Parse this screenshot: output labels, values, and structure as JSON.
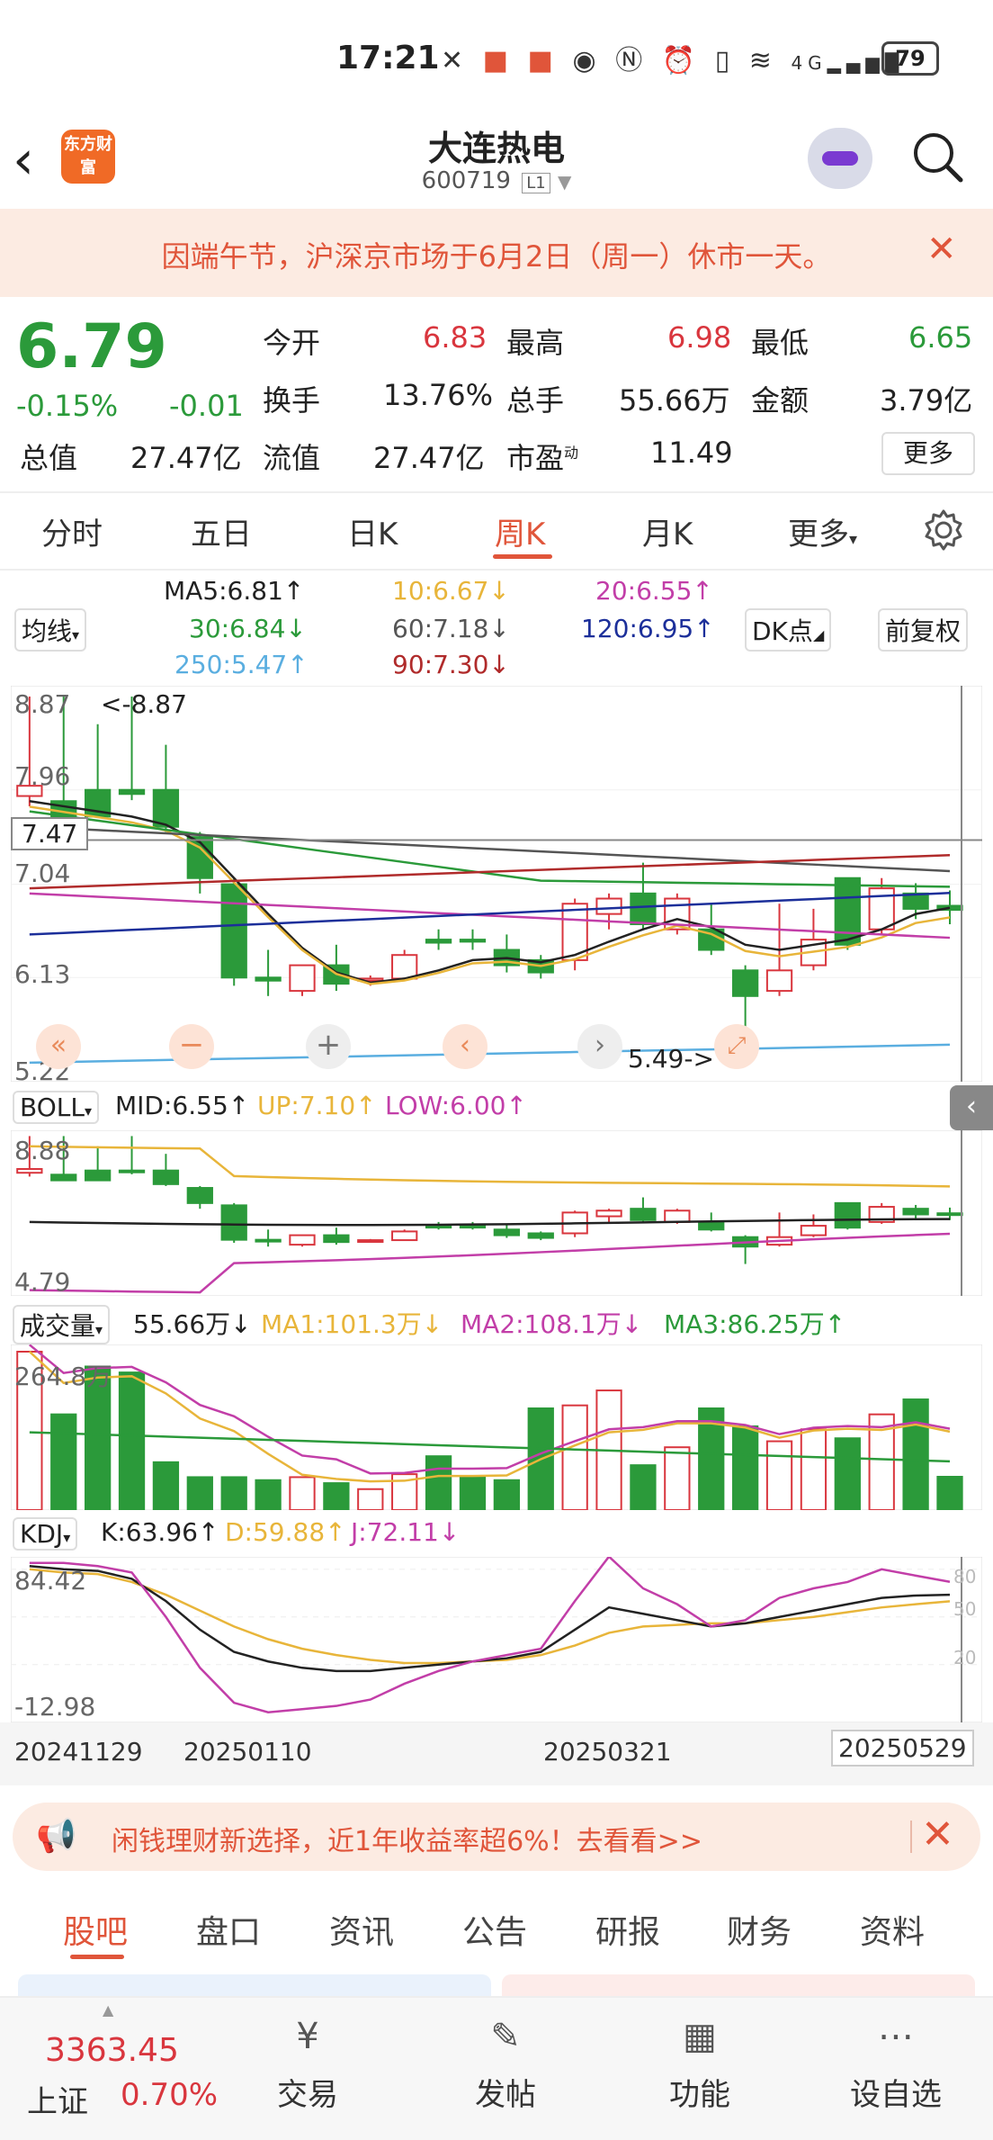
{
  "status": {
    "time": "17:21",
    "battery": "79",
    "network": "4G"
  },
  "header": {
    "logo": "东方财富",
    "name": "大连热电",
    "code": "600719",
    "tag": "L1"
  },
  "notice": {
    "text": "因端午节，沪深京市场于6月2日（周一）休市一天。"
  },
  "quote": {
    "price": "6.79",
    "change_pct": "-0.15%",
    "change": "-0.01",
    "open_label": "今开",
    "open": "6.83",
    "high_label": "最高",
    "high": "6.98",
    "low_label": "最低",
    "low": "6.65",
    "turnover_label": "换手",
    "turnover": "13.76%",
    "volume_label": "总手",
    "volume": "55.66万",
    "amount_label": "金额",
    "amount": "3.79亿",
    "mcap_label": "总值",
    "mcap": "27.47亿",
    "float_label": "流值",
    "float": "27.47亿",
    "pe_label": "市盈",
    "pe_sup": "动",
    "pe": "11.49",
    "more": "更多"
  },
  "tabs": [
    "分时",
    "五日",
    "日K",
    "周K",
    "月K",
    "更多"
  ],
  "ma": {
    "selector": "均线",
    "ma5": "MA5:6.81↑",
    "ma10": "10:6.67↓",
    "ma20": "20:6.55↑",
    "ma30": "30:6.84↓",
    "ma60": "60:7.18↓",
    "ma120": "120:6.95↑",
    "ma250": "250:5.47↑",
    "ma90": "90:7.30↓",
    "dk": "DK点",
    "adjust": "前复权",
    "colors": {
      "ma5": "#222222",
      "ma10": "#e8b53a",
      "ma20": "#c23ea8",
      "ma30": "#2b9a3a",
      "ma60": "#555555",
      "ma120": "#1c2f9a",
      "ma250": "#5aaee0",
      "ma90": "#b02b2b"
    }
  },
  "main_chart": {
    "y_labels": [
      "8.87",
      "7.96",
      "7.04",
      "6.13",
      "5.22"
    ],
    "current_price_tag": "7.47",
    "high_marker": "<-8.87",
    "low_marker": "5.49->"
  },
  "boll": {
    "selector": "BOLL",
    "mid": "MID:6.55↑",
    "up": "UP:7.10↑",
    "low": "LOW:6.00↑",
    "y_top": "8.88",
    "y_bottom": "4.79"
  },
  "volume": {
    "selector": "成交量",
    "value": "55.66万↓",
    "ma1": "MA1:101.3万↓",
    "ma2": "MA2:108.1万↓",
    "ma3": "MA3:86.25万↑",
    "y_top": "264.8万"
  },
  "kdj": {
    "selector": "KDJ",
    "k": "K:63.96↑",
    "d": "D:59.88↑",
    "j": "J:72.11↓",
    "y_top": "84.42",
    "y_bottom": "-12.98",
    "levels": [
      "80",
      "50",
      "20"
    ]
  },
  "x_dates": [
    "20241129",
    "20250110",
    "20250321",
    "20250529"
  ],
  "ad": {
    "text": "闲钱理财新选择，近1年收益率超6%！去看看>>"
  },
  "bottom_tabs": [
    "股吧",
    "盘口",
    "资讯",
    "公告",
    "研报",
    "财务",
    "资料"
  ],
  "footer": {
    "index_value": "3363.45",
    "index_name": "上证",
    "index_change": "0.70%",
    "items": [
      "交易",
      "发帖",
      "功能",
      "设自选"
    ]
  },
  "chart_data": {
    "type": "candlestick",
    "candles": [
      [
        7.9,
        8.0,
        7.8,
        8.87
      ],
      [
        7.85,
        7.7,
        7.7,
        8.87
      ],
      [
        7.96,
        7.7,
        7.7,
        8.6
      ],
      [
        7.96,
        7.92,
        7.86,
        8.87
      ],
      [
        7.96,
        7.6,
        7.55,
        8.4
      ],
      [
        7.5,
        7.1,
        6.95,
        7.55
      ],
      [
        7.04,
        6.13,
        6.05,
        7.1
      ],
      [
        6.13,
        6.1,
        5.95,
        6.4
      ],
      [
        6.0,
        6.25,
        5.95,
        6.25
      ],
      [
        6.25,
        6.07,
        6.0,
        6.45
      ],
      [
        6.1,
        6.12,
        6.05,
        6.15
      ],
      [
        6.12,
        6.35,
        6.1,
        6.4
      ],
      [
        6.5,
        6.47,
        6.4,
        6.6
      ],
      [
        6.5,
        6.48,
        6.4,
        6.6
      ],
      [
        6.4,
        6.25,
        6.18,
        6.55
      ],
      [
        6.3,
        6.18,
        6.12,
        6.35
      ],
      [
        6.3,
        6.85,
        6.2,
        6.9
      ],
      [
        6.75,
        6.9,
        6.6,
        6.95
      ],
      [
        6.95,
        6.65,
        6.6,
        7.25
      ],
      [
        6.6,
        6.9,
        6.55,
        6.95
      ],
      [
        6.6,
        6.4,
        6.35,
        6.85
      ],
      [
        6.2,
        5.95,
        5.49,
        6.25
      ],
      [
        6.0,
        6.2,
        5.95,
        6.85
      ],
      [
        6.25,
        6.5,
        6.2,
        6.8
      ],
      [
        7.1,
        6.45,
        6.4,
        7.1
      ],
      [
        6.6,
        7.0,
        6.55,
        7.1
      ],
      [
        6.95,
        6.8,
        6.7,
        7.05
      ],
      [
        6.83,
        6.79,
        6.65,
        6.98
      ]
    ],
    "ma5": [
      7.85,
      7.8,
      7.75,
      7.7,
      7.62,
      7.45,
      7.1,
      6.75,
      6.42,
      6.18,
      6.08,
      6.12,
      6.2,
      6.3,
      6.32,
      6.28,
      6.35,
      6.48,
      6.6,
      6.7,
      6.62,
      6.45,
      6.4,
      6.45,
      6.5,
      6.6,
      6.75,
      6.81
    ],
    "volumes": [
      264.8,
      160,
      240,
      230,
      80,
      55,
      55,
      50,
      55,
      45,
      35,
      60,
      90,
      55,
      50,
      170,
      175,
      200,
      75,
      105,
      170,
      140,
      115,
      135,
      120,
      160,
      185,
      55.66
    ]
  }
}
